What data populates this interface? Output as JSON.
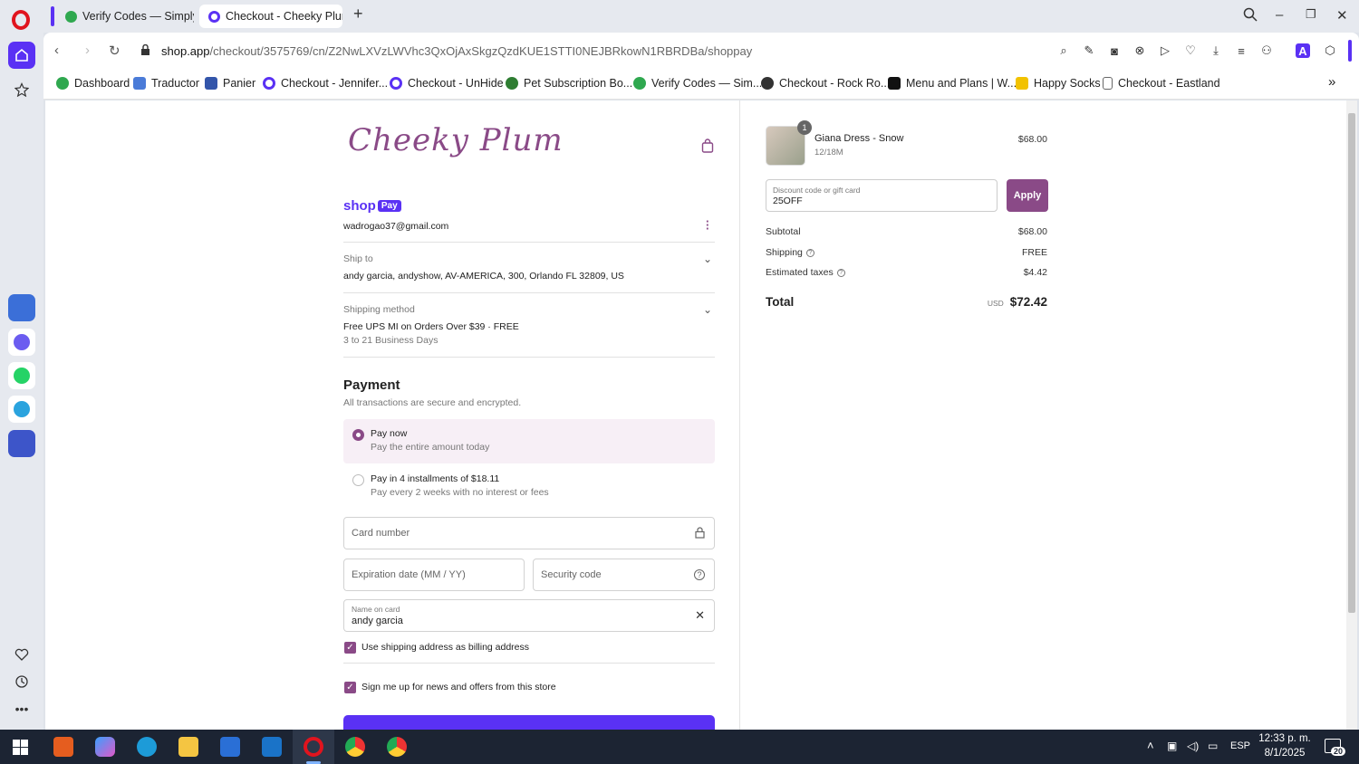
{
  "browser": {
    "tabs": [
      {
        "title": "Verify Codes — SimplyCo",
        "active": false
      },
      {
        "title": "Checkout - Cheeky Plum",
        "active": true
      }
    ],
    "url_host": "shop.app",
    "url_path": "/checkout/3575769/cn/Z2NwLXVzLWVhc3QxOjAxSkgzQzdKUE1STTI0NEJBRkowN1RBRDBa/shoppay",
    "bookmarks": [
      {
        "label": "Dashboard",
        "icon_color": "#2fa84f"
      },
      {
        "label": "Traductor",
        "icon_color": "#4a7bd8"
      },
      {
        "label": "Panier",
        "icon_color": "#3355aa"
      },
      {
        "label": "Checkout - Jennifer...",
        "icon_color": "#5a31f4"
      },
      {
        "label": "Checkout - UnHide",
        "icon_color": "#5a31f4"
      },
      {
        "label": "Pet Subscription Bo...",
        "icon_color": "#2e7d32"
      },
      {
        "label": "Verify Codes — Sim...",
        "icon_color": "#2fa84f"
      },
      {
        "label": "Checkout - Rock Ro...",
        "icon_color": "#333333"
      },
      {
        "label": "Menu and Plans | W...",
        "icon_color": "#111111"
      },
      {
        "label": "Happy Socks",
        "icon_color": "#f2c200"
      },
      {
        "label": "Checkout - Eastland",
        "icon_color": "#666666"
      }
    ]
  },
  "checkout": {
    "logo_text": "Cheeky Plum",
    "shoppay_word": "shop",
    "shoppay_badge": "Pay",
    "email": "wadrogao37@gmail.com",
    "ship_to_label": "Ship to",
    "ship_to_value": "andy garcia, andyshow, AV-AMERICA, 300, Orlando FL 32809, US",
    "shipping_method_label": "Shipping method",
    "shipping_method_value": "Free UPS MI on Orders Over $39 · FREE",
    "shipping_method_eta": "3 to 21 Business Days",
    "payment_heading": "Payment",
    "payment_sub": "All transactions are secure and encrypted.",
    "pay_now_title": "Pay now",
    "pay_now_sub": "Pay the entire amount today",
    "pay_install_title": "Pay in 4 installments of $18.11",
    "pay_install_sub": "Pay every 2 weeks with no interest or fees",
    "card_number_placeholder": "Card number",
    "expiration_placeholder": "Expiration date (MM / YY)",
    "security_placeholder": "Security code",
    "name_on_card_label": "Name on card",
    "name_on_card_value": "andy garcia",
    "billing_checkbox": "Use shipping address as billing address",
    "news_checkbox": "Sign me up for news and offers from this store"
  },
  "summary": {
    "item_name": "Giana Dress - Snow",
    "item_variant": "12/18M",
    "item_qty": "1",
    "item_price": "$68.00",
    "discount_label": "Discount code or gift card",
    "discount_value": "25OFF",
    "apply_label": "Apply",
    "subtotal_label": "Subtotal",
    "subtotal_value": "$68.00",
    "shipping_label": "Shipping",
    "shipping_value": "FREE",
    "taxes_label": "Estimated taxes",
    "taxes_value": "$4.42",
    "total_label": "Total",
    "total_currency": "USD",
    "total_value": "$72.42"
  },
  "taskbar": {
    "lang": "ESP",
    "time": "12:33 p. m.",
    "date": "8/1/2025",
    "notif_count": "20"
  },
  "colors": {
    "brand": "#8a4a87",
    "shoppay": "#5a31f4"
  }
}
